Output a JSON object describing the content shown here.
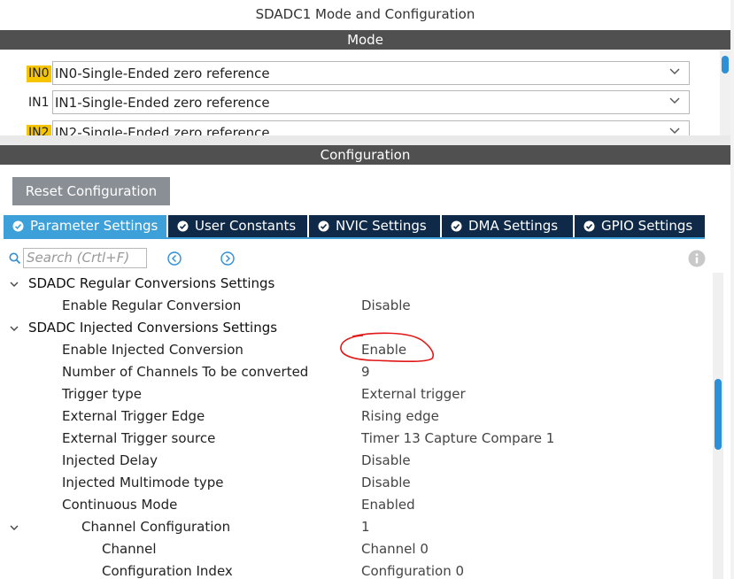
{
  "window": {
    "title": "SDADC1 Mode and Configuration"
  },
  "mode": {
    "section_label": "Mode",
    "rows": [
      {
        "pin": "IN0",
        "value": "IN0-Single-Ended zero reference"
      },
      {
        "pin": "IN1",
        "value": "IN1-Single-Ended zero reference"
      },
      {
        "pin": "IN2",
        "value": "IN2-Single-Ended zero reference"
      }
    ]
  },
  "configuration": {
    "section_label": "Configuration",
    "reset_label": "Reset Configuration",
    "tabs": [
      {
        "label": "Parameter Settings"
      },
      {
        "label": "User Constants"
      },
      {
        "label": "NVIC Settings"
      },
      {
        "label": "DMA Settings"
      },
      {
        "label": "GPIO Settings"
      }
    ],
    "search": {
      "placeholder": "Search (Crtl+F)"
    }
  },
  "params": {
    "regular_header": "SDADC Regular Conversions Settings",
    "enable_regular": {
      "label": "Enable Regular Conversion",
      "value": "Disable"
    },
    "injected_header": "SDADC Injected Conversions Settings",
    "enable_injected": {
      "label": "Enable Injected Conversion",
      "value": "Enable"
    },
    "num_channels": {
      "label": "Number of Channels To be converted",
      "value": "9"
    },
    "trigger_type": {
      "label": "Trigger type",
      "value": "External trigger"
    },
    "ext_trigger_edge": {
      "label": "External Trigger Edge",
      "value": "Rising edge"
    },
    "ext_trigger_source": {
      "label": "External Trigger source",
      "value": "Timer 13 Capture Compare 1"
    },
    "injected_delay": {
      "label": "Injected Delay",
      "value": "Disable"
    },
    "injected_multimode": {
      "label": "Injected Multimode type",
      "value": "Disable"
    },
    "continuous_mode": {
      "label": "Continuous Mode",
      "value": "Enabled"
    },
    "channel_config": {
      "label": "Channel Configuration",
      "value": "1"
    },
    "channel": {
      "label": "Channel",
      "value": "Channel 0"
    },
    "config_index": {
      "label": "Configuration Index",
      "value": "Configuration 0"
    }
  },
  "colors": {
    "accent": "#3ea0d8",
    "tab_dark": "#0e2a48",
    "bar": "#505050",
    "highlight": "#f6c500",
    "annotation": "#e01818"
  },
  "icons": [
    "chevron-down-icon",
    "check-circle-icon",
    "search-icon",
    "prev-circle-icon",
    "next-circle-icon",
    "info-icon",
    "expand-chevron-icon"
  ]
}
